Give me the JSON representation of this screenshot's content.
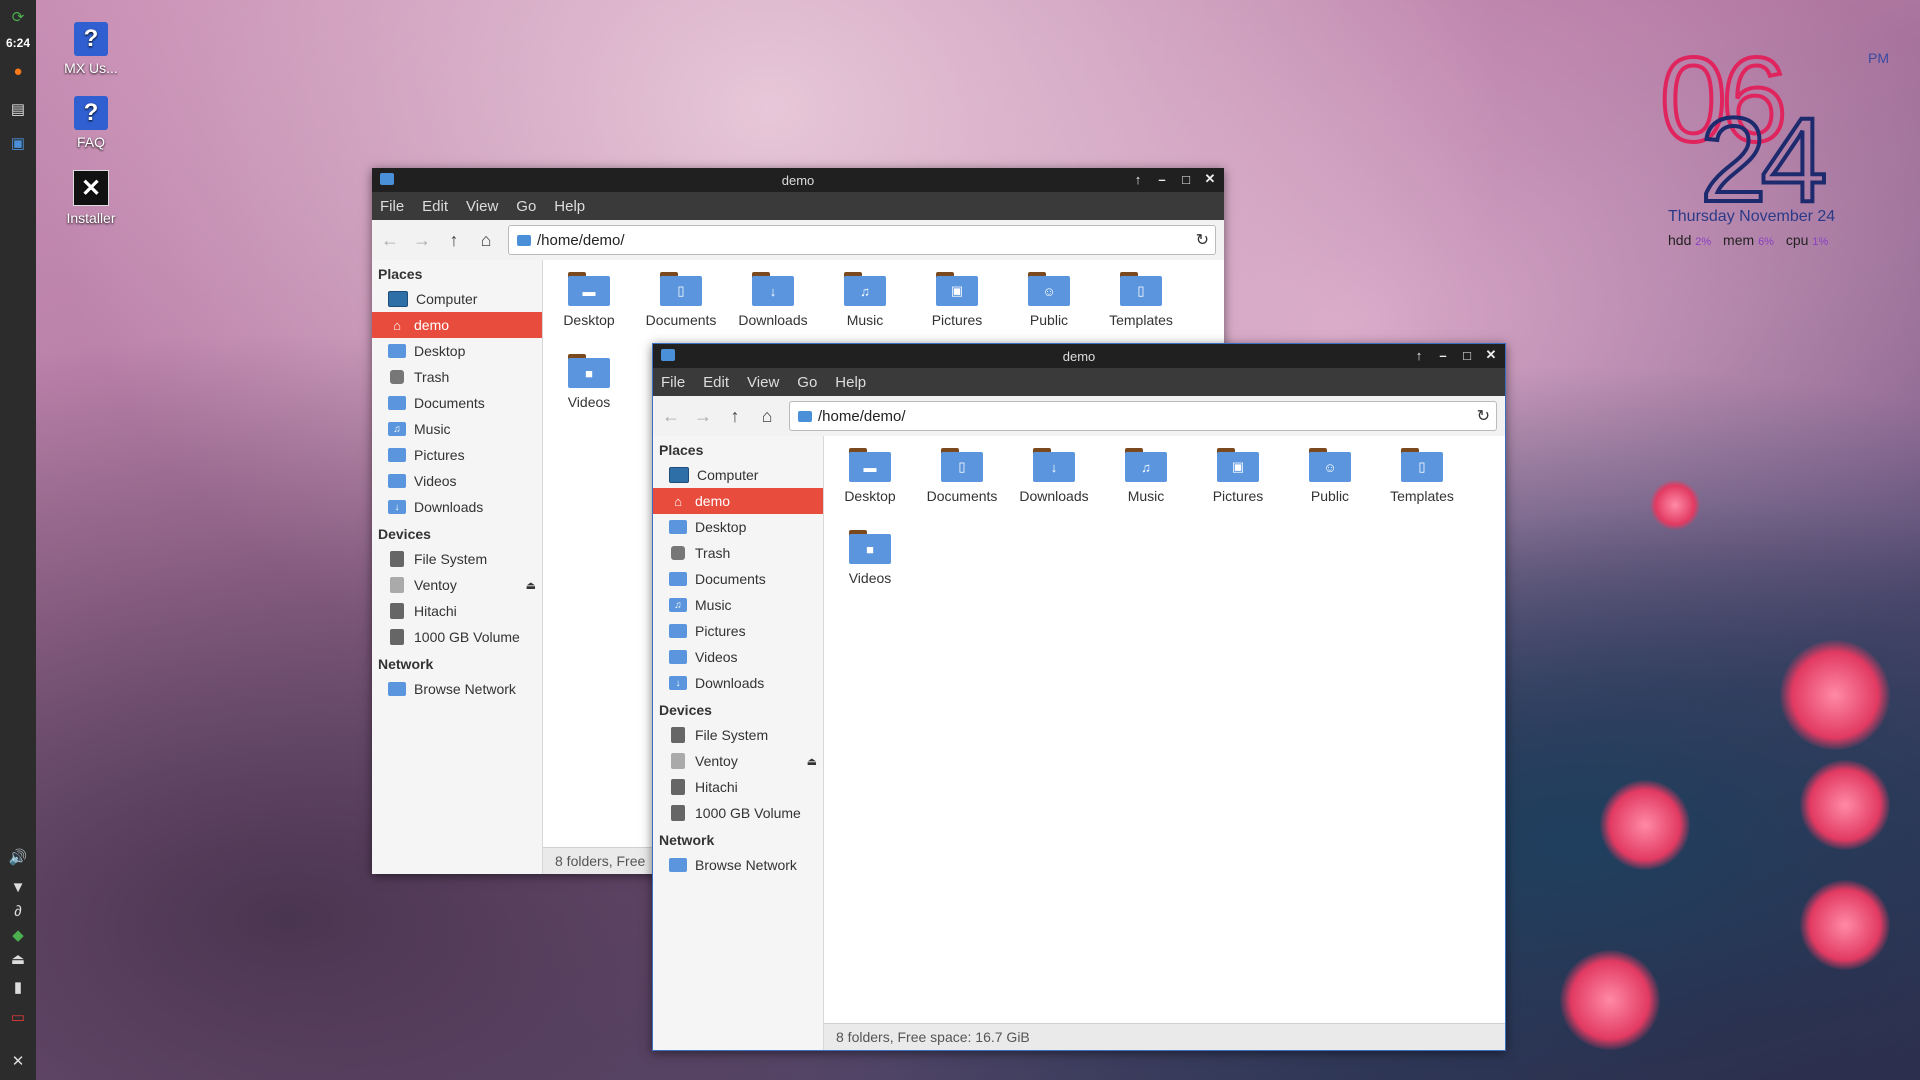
{
  "panel": {
    "clock": "6:24"
  },
  "desktop_icons": [
    {
      "label": "MX Us..."
    },
    {
      "label": "FAQ"
    },
    {
      "label": "Installer"
    }
  ],
  "conky": {
    "hour": "06",
    "minute": "24",
    "ampm": "PM",
    "date": "Thursday November 24",
    "hdd_label": "hdd",
    "hdd_val": "2%",
    "mem_label": "mem",
    "mem_val": "6%",
    "cpu_label": "cpu",
    "cpu_val": "1%"
  },
  "window_back": {
    "title": "demo",
    "menu": [
      "File",
      "Edit",
      "View",
      "Go",
      "Help"
    ],
    "path": "/home/demo/",
    "status": "8 folders, Free"
  },
  "window_front": {
    "title": "demo",
    "menu": [
      "File",
      "Edit",
      "View",
      "Go",
      "Help"
    ],
    "path": "/home/demo/",
    "status": "8 folders, Free space: 16.7 GiB"
  },
  "sidebar": {
    "places_heading": "Places",
    "places": [
      "Computer",
      "demo",
      "Desktop",
      "Trash",
      "Documents",
      "Music",
      "Pictures",
      "Videos",
      "Downloads"
    ],
    "devices_heading": "Devices",
    "devices": [
      "File System",
      "Ventoy",
      "Hitachi",
      "1000 GB Volume"
    ],
    "network_heading": "Network",
    "network": [
      "Browse Network"
    ]
  },
  "folders": [
    "Desktop",
    "Documents",
    "Downloads",
    "Music",
    "Pictures",
    "Public",
    "Templates",
    "Videos"
  ]
}
